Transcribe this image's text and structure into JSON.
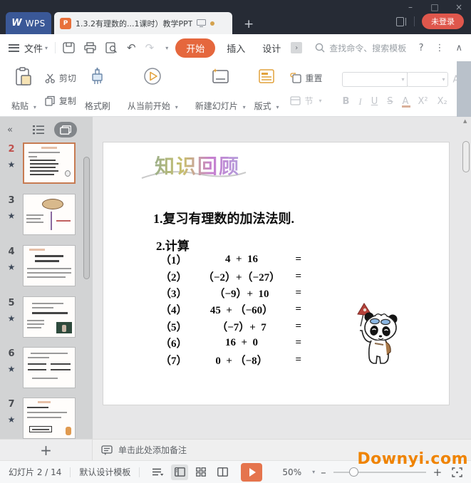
{
  "titlebar": {
    "wps": "WPS",
    "doc_title": "1.3.2有理数的...1课时）教学PPT",
    "new_tab": "+",
    "login": "未登录",
    "minimize": "–",
    "maximize": "□",
    "close": "×"
  },
  "menubar": {
    "file": "文件",
    "home": "开始",
    "insert": "插入",
    "design": "设计",
    "more_tabs": "›",
    "search": "查找命令、搜索模板",
    "help": "?",
    "kebab": "⋮",
    "collapse": "∧",
    "undo": "↶",
    "redo": "↷"
  },
  "ribbon": {
    "paste": "粘贴",
    "cut": "剪切",
    "copy": "复制",
    "format_painter": "格式刷",
    "from_current": "从当前开始",
    "new_slide": "新建幻灯片",
    "layout": "版式",
    "reset": "重置",
    "section": "节",
    "bold": "B",
    "italic": "I",
    "underline": "U",
    "strike": "S",
    "font_color": "A",
    "superscript": "X²",
    "subscript": "X₂"
  },
  "panel": {
    "collapse": "«",
    "slides": [
      {
        "number": "2"
      },
      {
        "number": "3"
      },
      {
        "number": "4"
      },
      {
        "number": "5"
      },
      {
        "number": "6"
      },
      {
        "number": "7"
      }
    ],
    "star": "★",
    "add": "+"
  },
  "slide": {
    "title": "知识回顾",
    "review_line": "1.复习有理数的加法法则.",
    "calc_label": "2.计算",
    "equations": [
      {
        "label": "（1）",
        "expr": "4  +  16",
        "eq": "="
      },
      {
        "label": "（2）",
        "expr": "（−2）+（−27）",
        "eq": "="
      },
      {
        "label": "（3）",
        "expr": "（−9）+  10",
        "eq": "="
      },
      {
        "label": "（4）",
        "expr": "45  + （−60）",
        "eq": "="
      },
      {
        "label": "（5）",
        "expr": "（−7）+  7",
        "eq": "="
      },
      {
        "label": "（6）",
        "expr": "16  +  0",
        "eq": "="
      },
      {
        "label": "（7）",
        "expr": "0  + （−8）",
        "eq": "="
      }
    ]
  },
  "notes": {
    "placeholder": "单击此处添加备注"
  },
  "statusbar": {
    "slide_counter": "幻灯片 2 / 14",
    "template_name": "默认设计模板",
    "zoom_level": "50%",
    "zoom_minus": "–",
    "zoom_plus": "+"
  },
  "watermark": "Downyi.com",
  "colors": {
    "accent_orange": "#e5673d",
    "tab_blue": "#3a5897",
    "login_red": "#df574c",
    "watermark_orange": "#ef8300",
    "selected_thumb_border": "#c77b52"
  }
}
